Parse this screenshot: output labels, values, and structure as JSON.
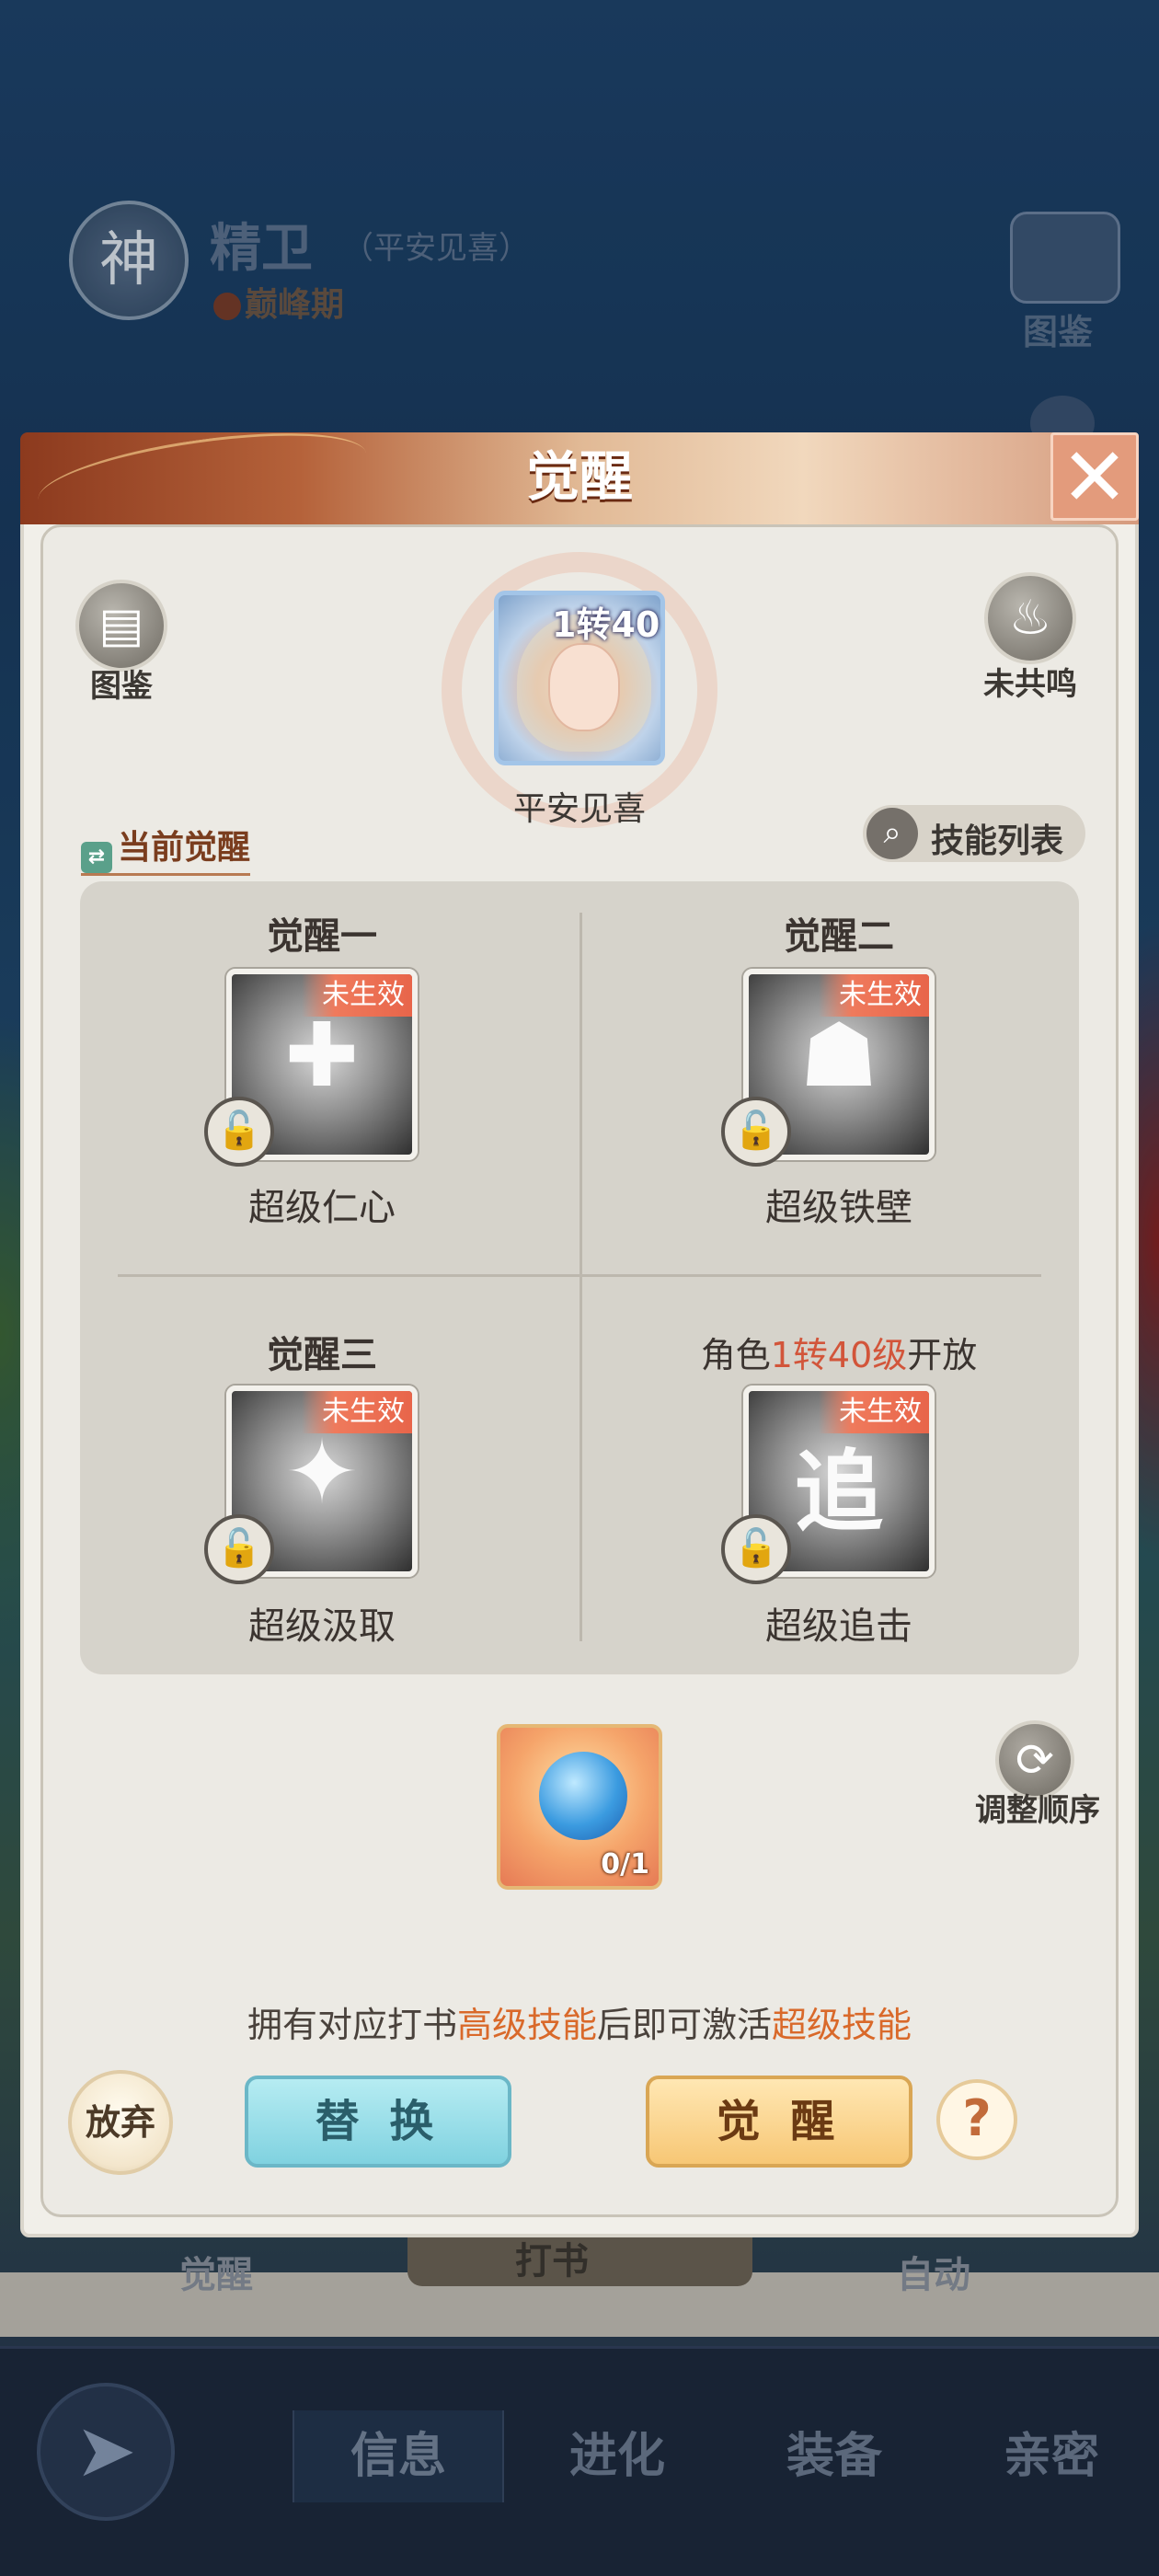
{
  "background": {
    "badge_char": "神",
    "character_name": "精卫",
    "character_title": "（平安见喜）",
    "character_stage": "巅峰期",
    "book_label": "图鉴",
    "awaken_label": "觉醒",
    "dashu_label": "打书",
    "auto_label": "自动"
  },
  "bottom_nav": {
    "back_icon": "back-arrow",
    "tabs": [
      {
        "label": "信息",
        "active": true
      },
      {
        "label": "进化",
        "active": false
      },
      {
        "label": "装备",
        "active": false
      },
      {
        "label": "亲密",
        "active": false
      }
    ]
  },
  "modal": {
    "title": "觉醒",
    "close_glyph": "✕",
    "codex": {
      "label": "图鉴",
      "icon": "book-icon"
    },
    "resonance": {
      "label": "未共鸣",
      "icon": "flame-icon"
    },
    "portrait": {
      "level": "1转40",
      "name": "平安见喜"
    },
    "current_awaken_label": "当前觉醒",
    "skill_list_label": "技能列表",
    "slots": [
      {
        "title": "觉醒一",
        "tag": "未生效",
        "skill": "超级仁心",
        "glyph": "✚"
      },
      {
        "title": "觉醒二",
        "tag": "未生效",
        "skill": "超级铁壁",
        "glyph": "☗"
      },
      {
        "title": "觉醒三",
        "tag": "未生效",
        "skill": "超级汲取",
        "glyph": "✦"
      },
      {
        "title_prefix": "角色",
        "title_highlight": "1转40级",
        "title_suffix": "开放",
        "tag": "未生效",
        "skill": "超级追击",
        "glyph": "追"
      }
    ],
    "item": {
      "count": "0/1"
    },
    "reorder_label": "调整顺序",
    "hint": {
      "part1": "拥有对应打书",
      "highlight1": "高级技能",
      "part2": "后即可激活",
      "highlight2": "超级技能"
    },
    "buttons": {
      "give_up": "放弃",
      "replace": "替 换",
      "awaken": "觉 醒",
      "help": "?"
    }
  },
  "colors": {
    "accent_orange": "#d9692a",
    "tag_red": "#e8654a",
    "highlight_red": "#d2553a"
  }
}
